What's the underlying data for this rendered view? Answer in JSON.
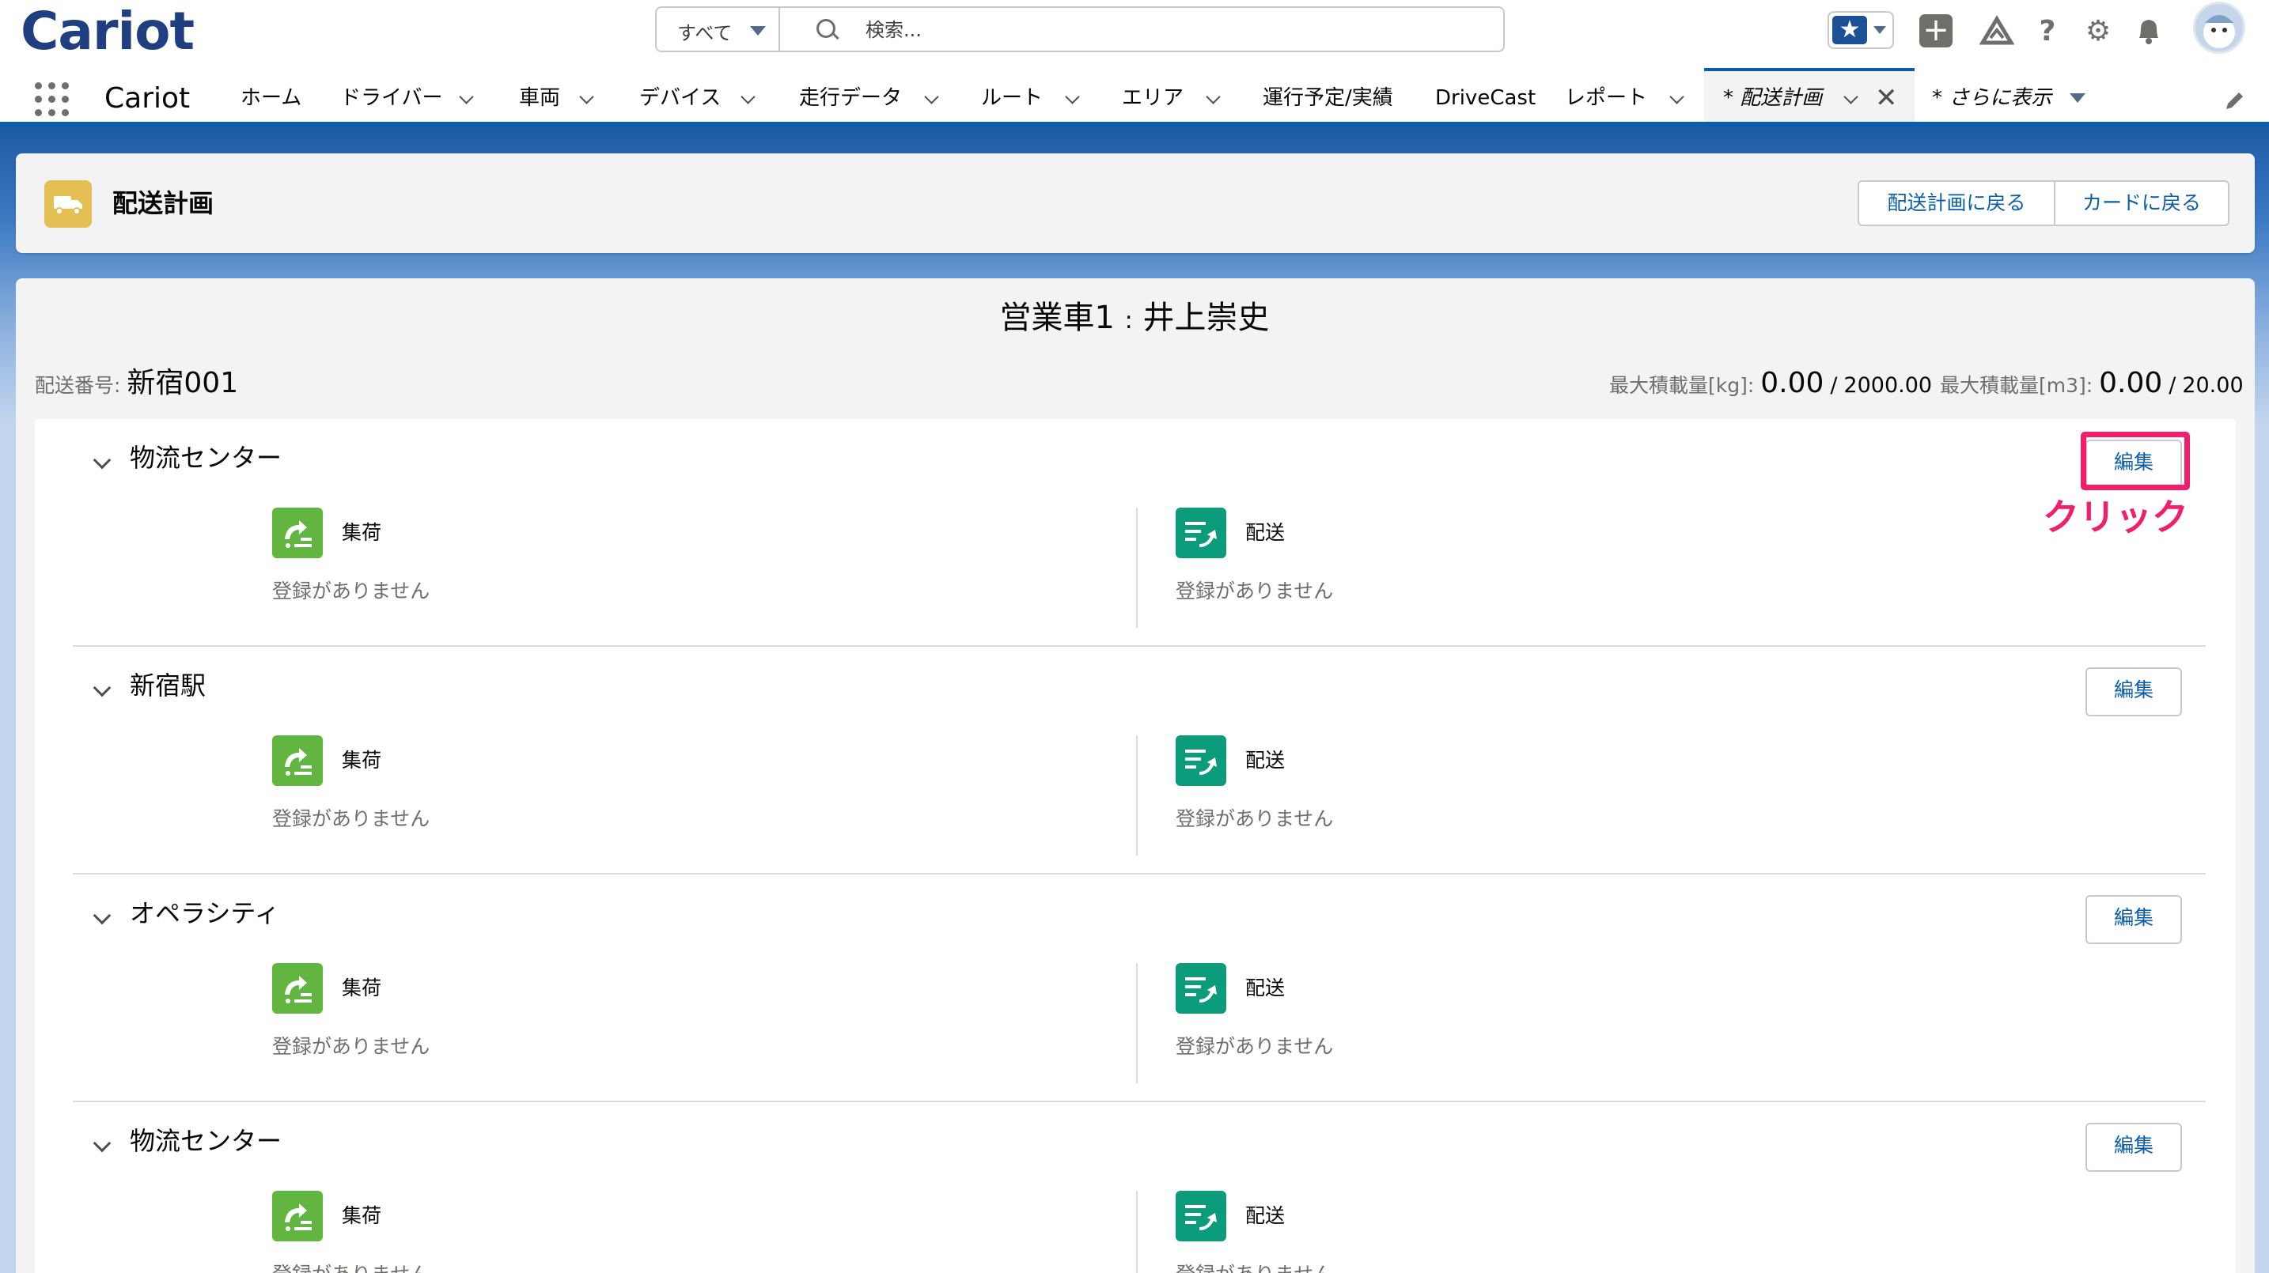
{
  "header": {
    "logo": "Cariot",
    "search_scope": "すべて",
    "search_placeholder": "検索..."
  },
  "icons": {
    "favorites": "star-icon",
    "add": "plus-icon",
    "trailhead": "trailhead-icon",
    "help": "question-icon",
    "setup": "gear-icon",
    "notifications": "bell-icon",
    "user": "avatar"
  },
  "nav": {
    "app_name": "Cariot",
    "items": [
      {
        "label": "ホーム",
        "dropdown": false
      },
      {
        "label": "ドライバー",
        "dropdown": true
      },
      {
        "label": "車両",
        "dropdown": true
      },
      {
        "label": "デバイス",
        "dropdown": true
      },
      {
        "label": "走行データ",
        "dropdown": true
      },
      {
        "label": "ルート",
        "dropdown": true
      },
      {
        "label": "エリア",
        "dropdown": true
      },
      {
        "label": "運行予定/実績",
        "dropdown": false
      },
      {
        "label": "DriveCast",
        "dropdown": false
      },
      {
        "label": "レポート",
        "dropdown": true
      }
    ],
    "active_tab": "* 配送計画",
    "more_tab": "* さらに表示"
  },
  "page_header": {
    "title": "配送計画",
    "back_to_plan": "配送計画に戻る",
    "back_to_card": "カードに戻る"
  },
  "plan": {
    "vehicle": "営業車1",
    "separator": ":",
    "driver": "井上崇史",
    "delivery_no_label": "配送番号:",
    "delivery_no": "新宿001",
    "max_weight_label": "最大積載量[kg]:",
    "max_weight_value": "0.00",
    "max_weight_limit": "2000.00",
    "max_volume_label": "最大積載量[m3]:",
    "max_volume_value": "0.00",
    "max_volume_limit": "20.00",
    "slash": "/"
  },
  "stops": [
    {
      "name": "物流センター",
      "pickup_label": "集荷",
      "pickup_empty": "登録がありません",
      "delivery_label": "配送",
      "delivery_empty": "登録がありません",
      "edit_label": "編集"
    },
    {
      "name": "新宿駅",
      "pickup_label": "集荷",
      "pickup_empty": "登録がありません",
      "delivery_label": "配送",
      "delivery_empty": "登録がありません",
      "edit_label": "編集"
    },
    {
      "name": "オペラシティ",
      "pickup_label": "集荷",
      "pickup_empty": "登録がありません",
      "delivery_label": "配送",
      "delivery_empty": "登録がありません",
      "edit_label": "編集"
    },
    {
      "name": "物流センター",
      "pickup_label": "集荷",
      "pickup_empty": "登録がありません",
      "delivery_label": "配送",
      "delivery_empty": "登録がありません",
      "edit_label": "編集"
    }
  ],
  "annotation": {
    "note": "クリック",
    "color": "#ef1f6e"
  },
  "colors": {
    "brand_blue": "#0b5cab",
    "pickup_green": "#62b541",
    "delivery_teal": "#0c9c7c",
    "object_icon_yellow": "#e3bf54"
  }
}
